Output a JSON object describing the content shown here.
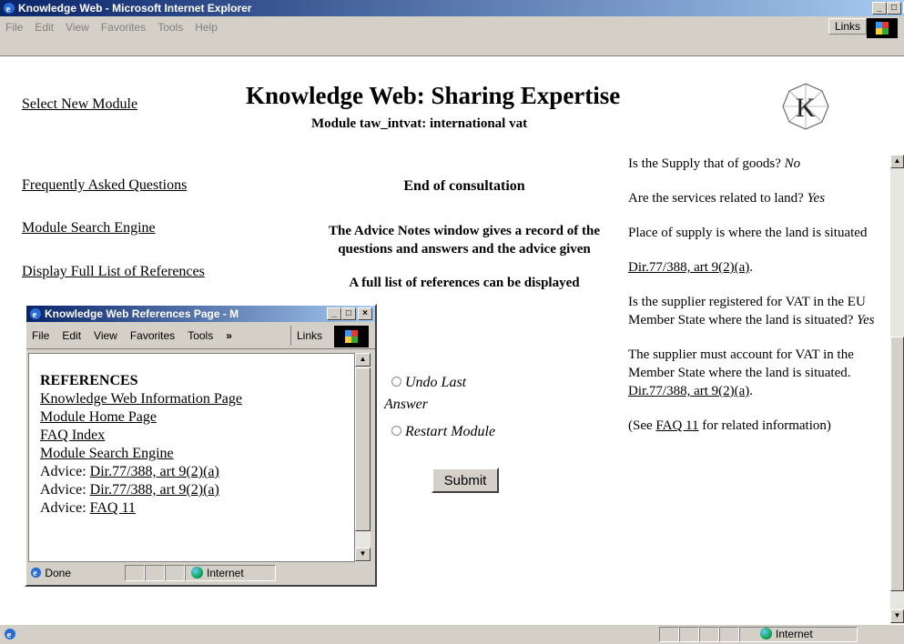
{
  "main_window": {
    "title": "Knowledge Web - Microsoft Internet Explorer",
    "menu": [
      "File",
      "Edit",
      "View",
      "Favorites",
      "Tools",
      "Help"
    ],
    "links_label": "Links",
    "status_zone": "Internet"
  },
  "page": {
    "select_new_module": "Select New Module",
    "title": "Knowledge Web: Sharing Expertise",
    "subtitle": "Module taw_intvat: international vat",
    "nav": {
      "faq": "Frequently Asked Questions",
      "search": "Module Search Engine",
      "refs": "Display Full List of References"
    },
    "middle": {
      "end_title": "End of consultation",
      "advice_text": "The Advice Notes window gives a record of the questions and answers and the advice given",
      "full_list": "A full list of references can be displayed",
      "undo_label": "Undo Last",
      "undo_label_2": "Answer",
      "restart_label": "Restart Module",
      "submit": "Submit"
    }
  },
  "advice_notes": {
    "q1": "Is the Supply that of goods?",
    "a1": "No",
    "q2": "Are the services related to land?",
    "a2": "Yes",
    "statement1": "Place of supply is where the land is situated",
    "ref1": "Dir.77/388, art 9(2)(a)",
    "q3": "Is the supplier registered for VAT in the EU Member State where the land is situated?",
    "a3": "Yes",
    "statement2": "The supplier must account for VAT in the Member State where the land is situated.",
    "ref2": "Dir.77/388, art 9(2)(a)",
    "see_prefix": "(See",
    "see_link": "FAQ 11",
    "see_suffix": "for related information)"
  },
  "popup": {
    "title": "Knowledge Web References Page - M",
    "menu": [
      "File",
      "Edit",
      "View",
      "Favorites",
      "Tools"
    ],
    "chevron": "»",
    "links_label": "Links",
    "heading": "REFERENCES",
    "items": {
      "info_page": "Knowledge Web Information Page",
      "module_home": "Module Home Page",
      "faq_index": "FAQ Index",
      "search_engine": "Module Search Engine",
      "advice_prefix": "Advice:",
      "advice1": "Dir.77/388, art 9(2)(a)",
      "advice2": "Dir.77/388, art 9(2)(a)",
      "advice3": "FAQ 11"
    },
    "status_done": "Done",
    "status_zone": "Internet"
  },
  "colors": {
    "titlebar_start": "#0a246a",
    "titlebar_end": "#a6caf0",
    "chrome": "#d4d0c8"
  }
}
